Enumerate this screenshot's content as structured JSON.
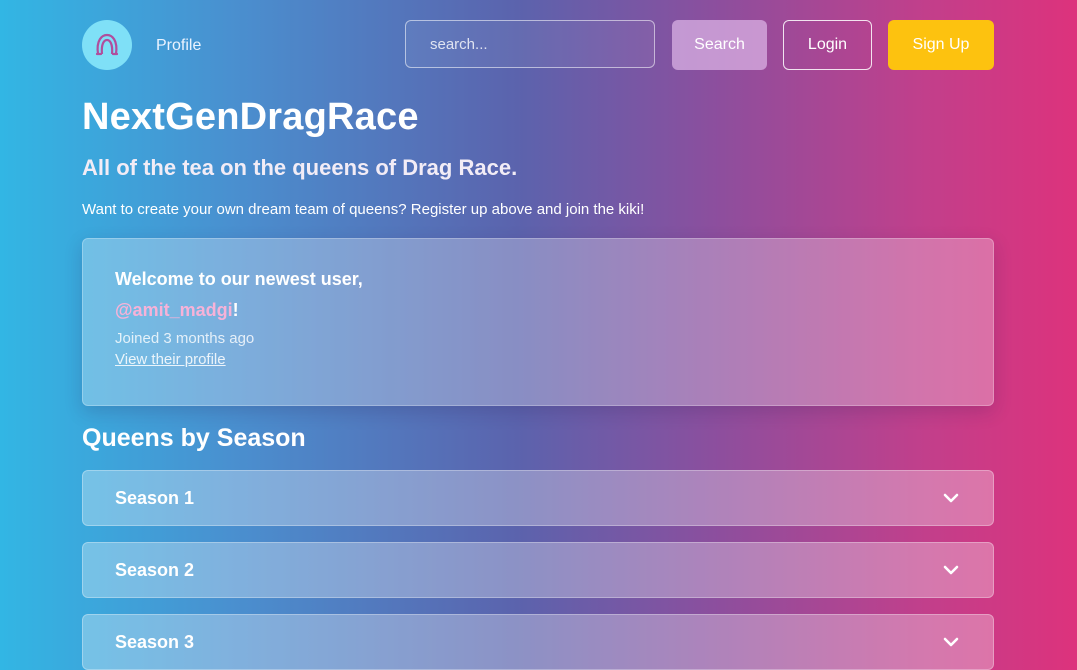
{
  "nav": {
    "profile_label": "Profile",
    "search_placeholder": "search...",
    "search_button": "Search",
    "login_button": "Login",
    "signup_button": "Sign Up"
  },
  "hero": {
    "title": "NextGenDragRace",
    "tagline": "All of the tea on the queens of Drag Race.",
    "intro": "Want to create your own dream team of queens? Register up above and join the kiki!"
  },
  "welcome": {
    "heading": "Welcome to our newest user,",
    "handle": "@amit_madgi",
    "handle_suffix": "!",
    "joined": "Joined 3 months ago",
    "profile_link": "View their profile"
  },
  "seasons": {
    "title": "Queens by Season",
    "items": [
      {
        "label": "Season 1"
      },
      {
        "label": "Season 2"
      },
      {
        "label": "Season 3"
      }
    ]
  },
  "colors": {
    "signup_accent": "#fdc20f",
    "handle_color": "#f7b2d8",
    "logo_bg": "#7fe0f7"
  },
  "icons": [
    "wig-logo-icon",
    "chevron-down-icon"
  ]
}
